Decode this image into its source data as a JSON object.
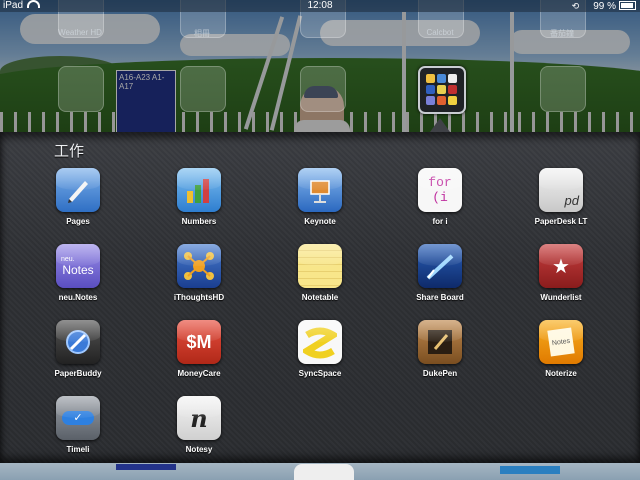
{
  "status_bar": {
    "carrier": "iPad",
    "time": "12:08",
    "battery": "99 %"
  },
  "home_row": {
    "labels": [
      "Weather HD",
      "相冊",
      "",
      "Calcbot",
      "番茄鐘"
    ]
  },
  "folder": {
    "title": "工作",
    "apps": [
      {
        "label": "Pages",
        "icon": "pages-icon"
      },
      {
        "label": "Numbers",
        "icon": "numbers-icon"
      },
      {
        "label": "Keynote",
        "icon": "keynote-icon"
      },
      {
        "label": "for i",
        "icon": "for-i-icon",
        "glyph": "for (i"
      },
      {
        "label": "PaperDesk LT",
        "icon": "paperdesk-icon",
        "glyph": "pd"
      },
      {
        "label": "neu.Notes",
        "icon": "neu-notes-icon",
        "glyph": "Notes",
        "glyph_small": "neu."
      },
      {
        "label": "iThoughtsHD",
        "icon": "ithoughts-icon"
      },
      {
        "label": "Notetable",
        "icon": "notetable-icon"
      },
      {
        "label": "Share Board",
        "icon": "share-board-icon"
      },
      {
        "label": "Wunderlist",
        "icon": "wunderlist-icon",
        "glyph": "★"
      },
      {
        "label": "PaperBuddy",
        "icon": "paperbuddy-icon"
      },
      {
        "label": "MoneyCare",
        "icon": "moneycare-icon",
        "glyph": "$M"
      },
      {
        "label": "SyncSpace",
        "icon": "syncspace-icon"
      },
      {
        "label": "DukePen",
        "icon": "dukepen-icon"
      },
      {
        "label": "Noterize",
        "icon": "noterize-icon",
        "glyph": "Notes"
      },
      {
        "label": "Timeli",
        "icon": "timeli-icon",
        "glyph": "✓"
      },
      {
        "label": "Notesy",
        "icon": "notesy-icon",
        "glyph": "n"
      }
    ]
  },
  "wallpaper_sign": {
    "line1": "A16-A23   A1-A17"
  },
  "colors": {
    "panel": "#2e3034",
    "label": "#ffffff",
    "statusbar": "#000000"
  }
}
